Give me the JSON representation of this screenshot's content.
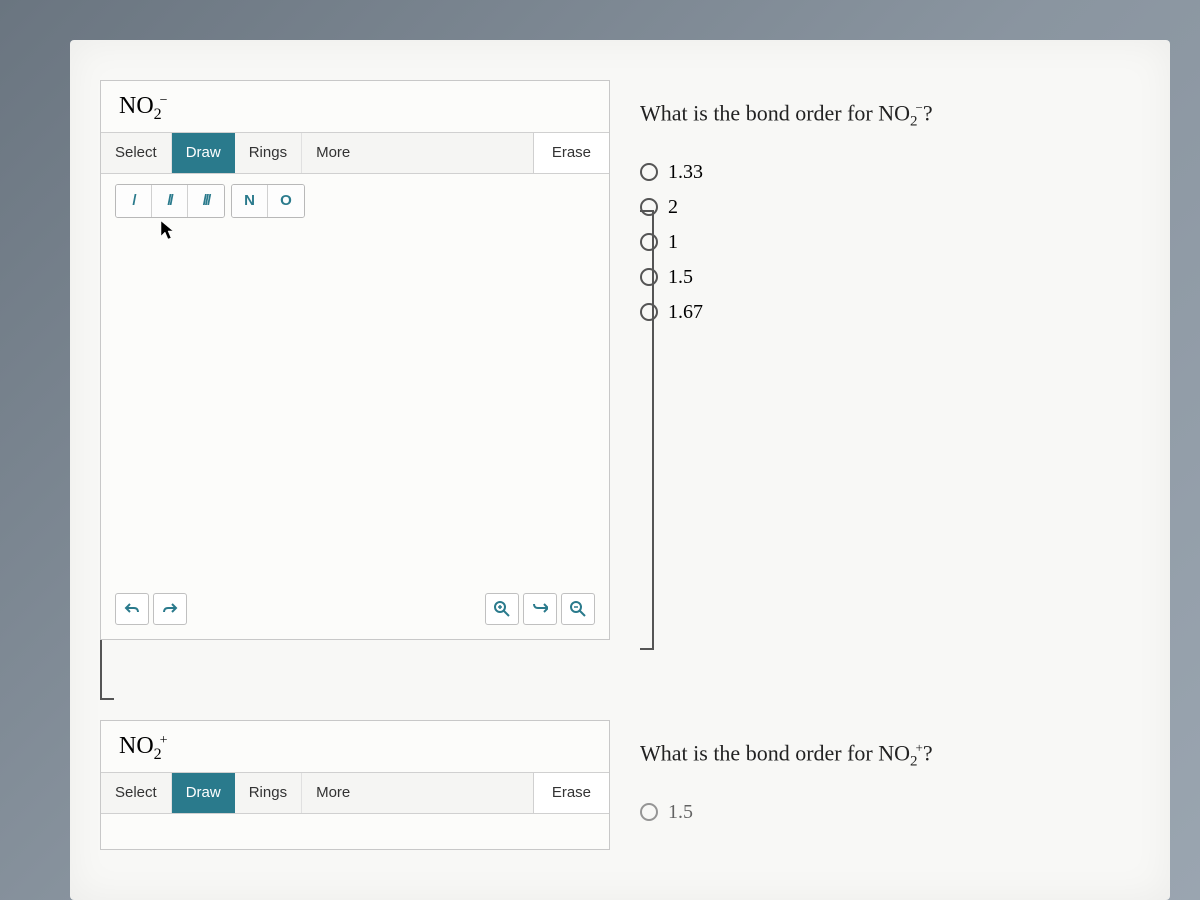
{
  "question1": {
    "molecule_base": "NO",
    "molecule_sub": "2",
    "molecule_sup": "−",
    "toolbar": {
      "select": "Select",
      "draw": "Draw",
      "rings": "Rings",
      "more": "More",
      "erase": "Erase"
    },
    "bonds": {
      "single": "/",
      "double": "//",
      "triple": "///",
      "n": "N",
      "o": "O"
    },
    "prompt_prefix": "What is the bond order for ",
    "prompt_base": "NO",
    "prompt_sub": "2",
    "prompt_sup": "−",
    "prompt_suffix": "?",
    "options": [
      "1.33",
      "2",
      "1",
      "1.5",
      "1.67"
    ]
  },
  "question2": {
    "molecule_base": "NO",
    "molecule_sub": "2",
    "molecule_sup": "+",
    "toolbar": {
      "select": "Select",
      "draw": "Draw",
      "rings": "Rings",
      "more": "More",
      "erase": "Erase"
    },
    "prompt_prefix": "What is the bond order for ",
    "prompt_base": "NO",
    "prompt_sub": "2",
    "prompt_sup": "+",
    "prompt_suffix": "?",
    "cut_option": "1.5"
  }
}
